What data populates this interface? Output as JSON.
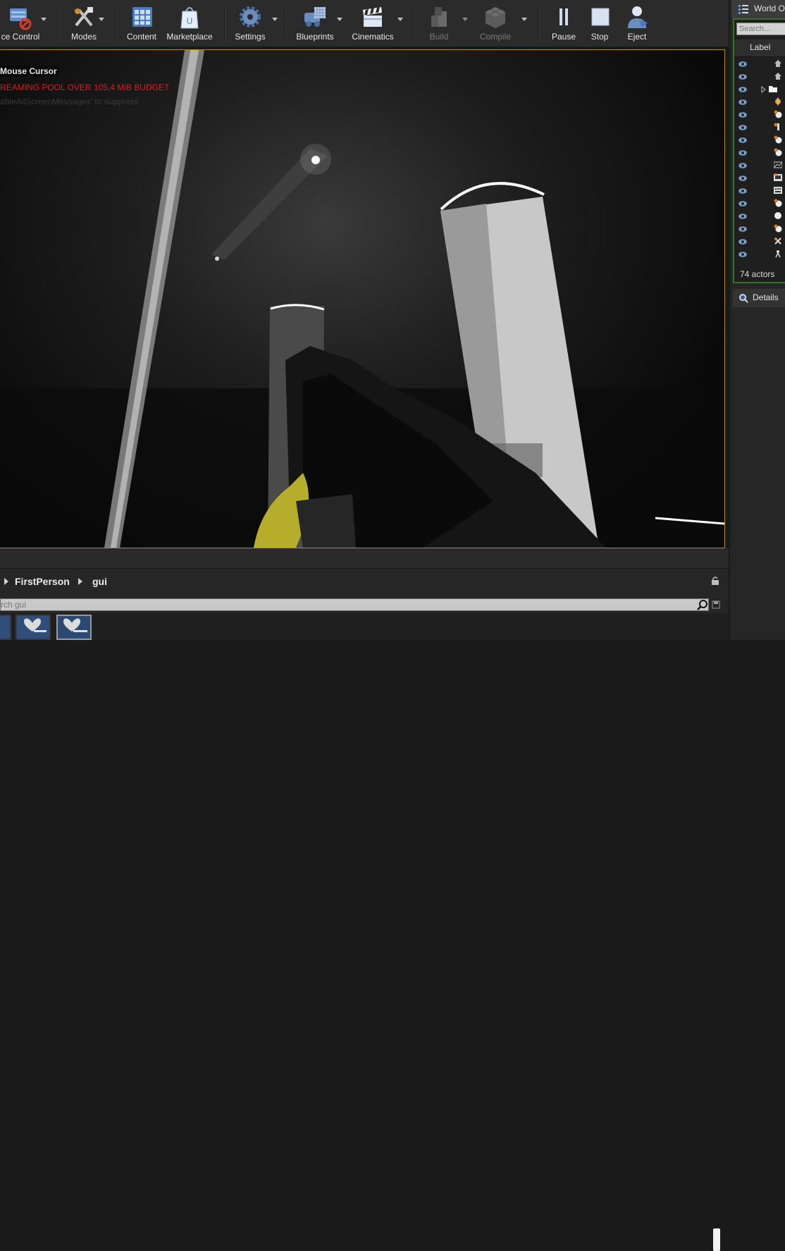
{
  "toolbar": {
    "items": [
      {
        "label": "ce Control",
        "icon": "source-control-icon"
      },
      {
        "label": "Modes",
        "icon": "modes-icon"
      },
      {
        "label": "Content",
        "icon": "content-icon"
      },
      {
        "label": "Marketplace",
        "icon": "marketplace-icon"
      },
      {
        "label": "Settings",
        "icon": "settings-icon"
      },
      {
        "label": "Blueprints",
        "icon": "blueprints-icon"
      },
      {
        "label": "Cinematics",
        "icon": "cinematics-icon"
      },
      {
        "label": "Build",
        "icon": "build-icon",
        "disabled": true
      },
      {
        "label": "Compile",
        "icon": "compile-icon",
        "disabled": true
      },
      {
        "label": "Pause",
        "icon": "pause-icon"
      },
      {
        "label": "Stop",
        "icon": "stop-icon"
      },
      {
        "label": "Eject",
        "icon": "eject-icon"
      }
    ]
  },
  "viewport": {
    "cursor_text": "Mouse Cursor",
    "warning_text": "REAMING POOL OVER 105,4 MiB BUDGET",
    "hint_text": "ableAllScreenMessages' to suppress",
    "border_color": "#b28a1e",
    "warning_color": "#e01a1a"
  },
  "content_browser": {
    "breadcrumbs": [
      "FirstPerson",
      "gui"
    ],
    "search_placeholder": "rch gui"
  },
  "world_outliner": {
    "tab_label": "World Ou",
    "search_placeholder": "Search...",
    "column_label": "Label",
    "actor_count": "74 actors",
    "border_color": "#3f6b2c"
  },
  "details": {
    "tab_label": "Details"
  }
}
